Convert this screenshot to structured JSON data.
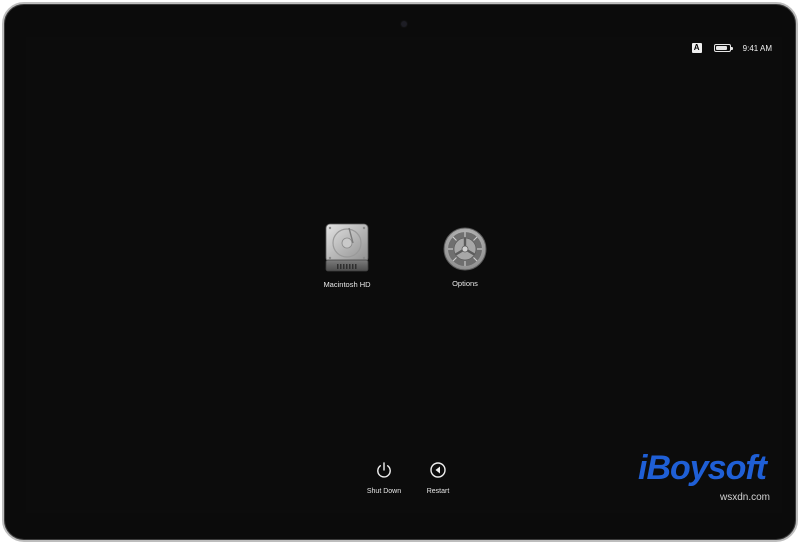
{
  "menubar": {
    "keyboard_indicator": "A",
    "time": "9:41 AM"
  },
  "volumes": [
    {
      "label": "Macintosh HD",
      "icon": "hard-drive-icon"
    },
    {
      "label": "Options",
      "icon": "gear-icon"
    }
  ],
  "power": {
    "shutdown_label": "Shut Down",
    "restart_label": "Restart"
  },
  "watermark": {
    "logo": "iBoysoft",
    "site": "wsxdn.com"
  },
  "colors": {
    "screen_bg": "#0c0c0c",
    "logo_blue": "#1f5fd6",
    "text": "#e8e8e8"
  }
}
